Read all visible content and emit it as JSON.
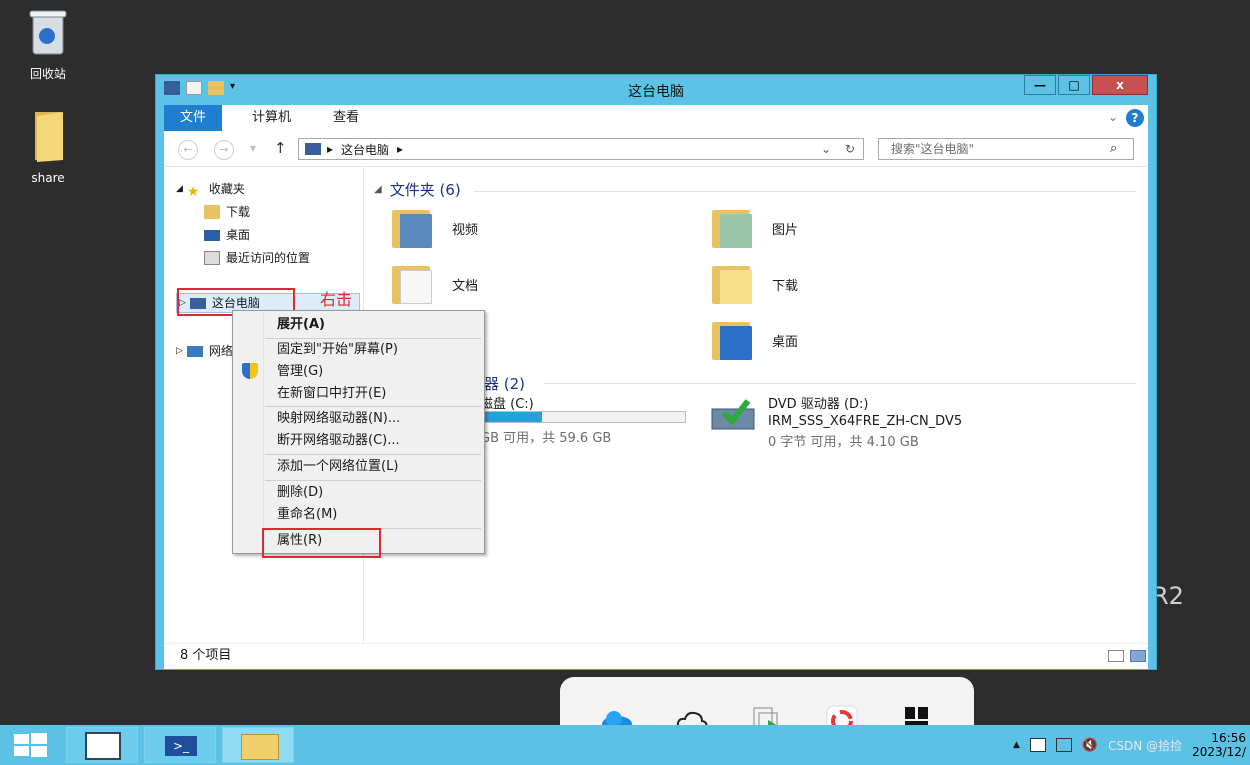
{
  "desktop": {
    "recycle_bin": "回收站",
    "share": "share",
    "edition_fragment": "R2"
  },
  "window": {
    "title": "这台电脑",
    "minimize": "—",
    "maximize": "□",
    "close": "x"
  },
  "ribbon": {
    "tabs": [
      "文件",
      "计算机",
      "查看"
    ]
  },
  "nav": {
    "address": "这台电脑",
    "search_placeholder": "搜索\"这台电脑\""
  },
  "sidebar": {
    "favorites": "收藏夹",
    "downloads": "下载",
    "desktop": "桌面",
    "recent": "最近访问的位置",
    "this_pc": "这台电脑",
    "network": "网络"
  },
  "annotation": "右击",
  "main": {
    "folders_title": "文件夹 (6)",
    "folders": [
      "视频",
      "图片",
      "文档",
      "下载",
      "桌面"
    ],
    "devices_title": "器 (2)",
    "drive_c": {
      "name": "磁盘 (C:)",
      "free": "GB 可用，共 59.6 GB",
      "used_fraction": 0.3
    },
    "drive_d": {
      "name": "DVD 驱动器 (D:)",
      "label": "IRM_SSS_X64FRE_ZH-CN_DV5",
      "free": "0 字节 可用，共 4.10 GB"
    }
  },
  "context_menu": {
    "expand": "展开(A)",
    "pin_start": "固定到\"开始\"屏幕(P)",
    "manage": "管理(G)",
    "open_new_window": "在新窗口中打开(E)",
    "map_drive": "映射网络驱动器(N)...",
    "disconnect_drive": "断开网络驱动器(C)...",
    "add_network_location": "添加一个网络位置(L)",
    "delete": "删除(D)",
    "rename": "重命名(M)",
    "properties": "属性(R)"
  },
  "status": {
    "items": "8 个项目"
  },
  "taskbar": {
    "time": "16:56",
    "date": "2023/12/",
    "watermark": "CSDN @拾捡"
  }
}
